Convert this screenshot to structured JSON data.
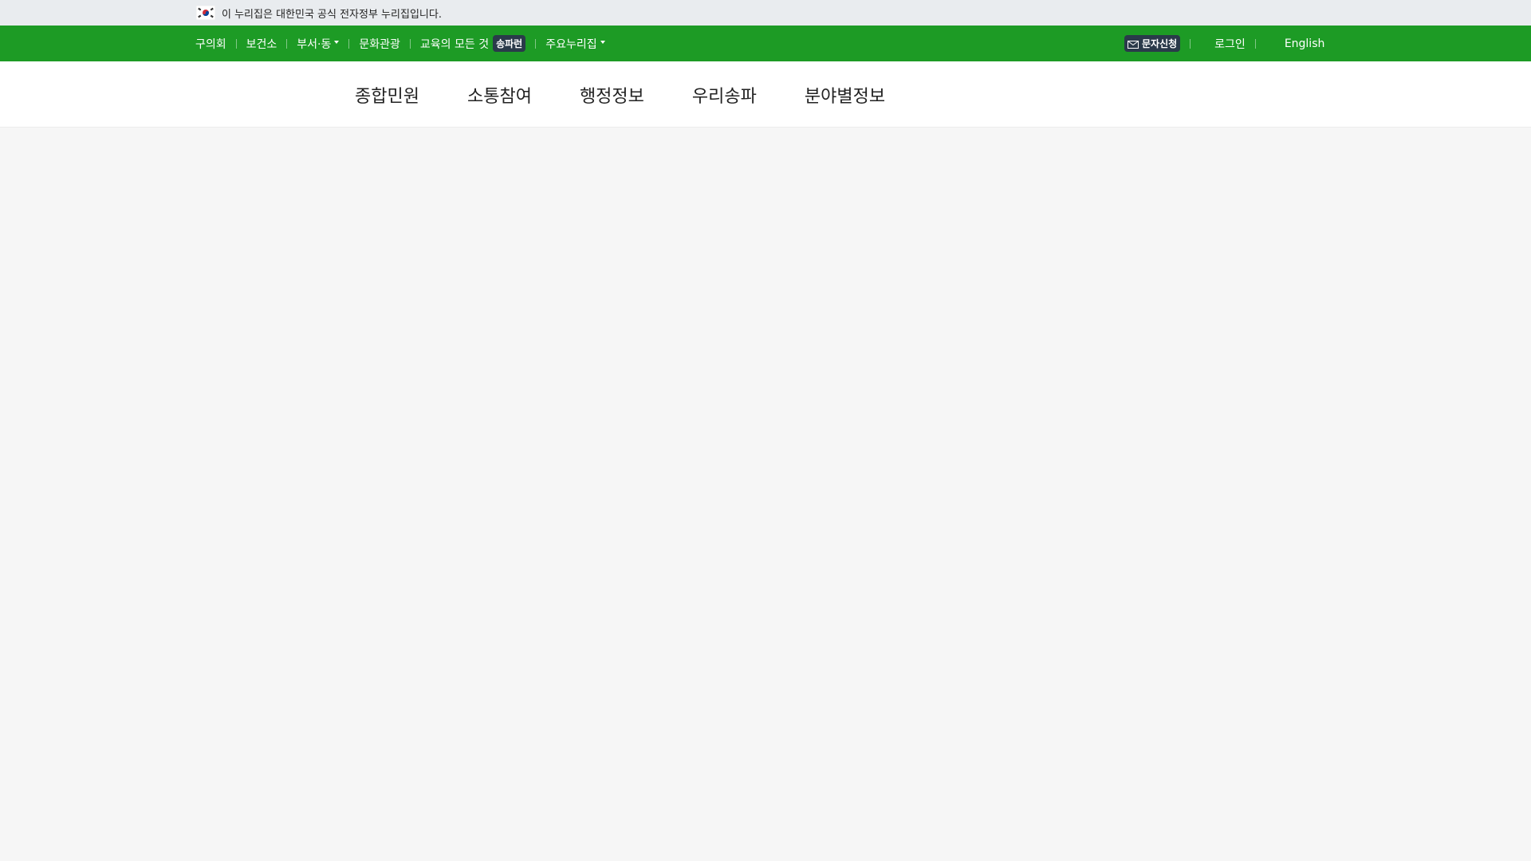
{
  "gov_notice": {
    "flag_icon": "korea-flag-icon",
    "text": "이 누리집은 대한민국 공식 전자정부 누리집입니다."
  },
  "utility": {
    "left_items": [
      {
        "label": "구의회"
      },
      {
        "label": "보건소"
      },
      {
        "label": "부서·동",
        "dropdown": true
      },
      {
        "label": "문화관광"
      },
      {
        "label": "교육의 모든 것",
        "badge": "송파런"
      },
      {
        "label": "주요누리집",
        "dropdown": true
      }
    ],
    "sms_label": "문자신청",
    "login_label": "로그인",
    "english_label": "English"
  },
  "main_menu": [
    {
      "label": "종합민원"
    },
    {
      "label": "소통참여"
    },
    {
      "label": "행정정보"
    },
    {
      "label": "우리송파"
    },
    {
      "label": "분야별정보"
    }
  ],
  "colors": {
    "green_bar": "#1d9b25",
    "gov_bar": "#e9ecef",
    "badge": "#2a3a4a",
    "page_bg": "#f6f6f6"
  }
}
